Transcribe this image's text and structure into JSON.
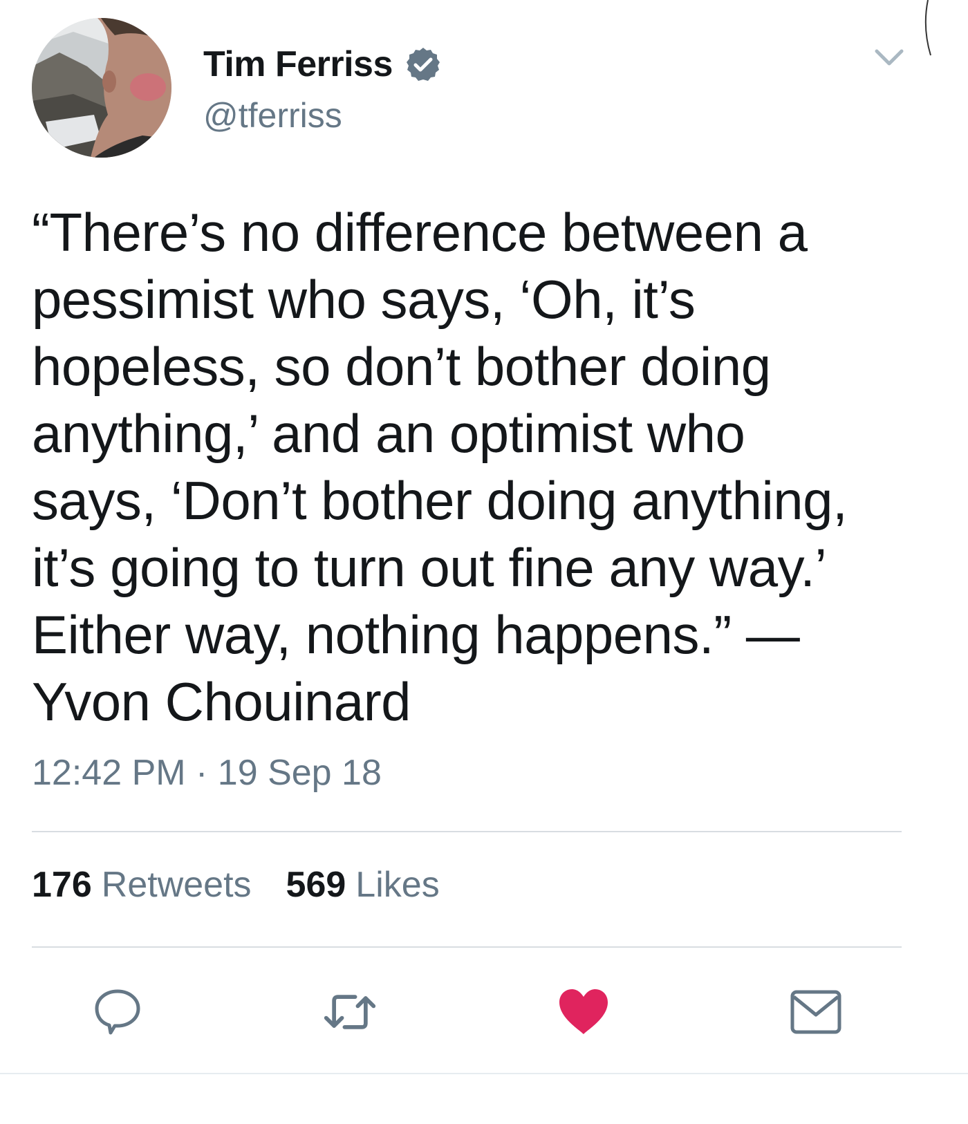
{
  "author": {
    "display_name": "Tim Ferriss",
    "handle": "@tferriss",
    "verified": true
  },
  "tweet": {
    "text": "“There’s no difference between a\npessimist who says, ‘Oh, it’s\nhopeless, so don’t bother doing\nanything,’ and an optimist who\nsays, ‘Don’t bother doing anything,\nit’s going to turn out fine any way.’\nEither way, nothing happens.” —\nYvon Chouinard",
    "timestamp": "12:42 PM · 19 Sep 18"
  },
  "stats": {
    "retweets_count": "176",
    "retweets_label": "Retweets",
    "likes_count": "569",
    "likes_label": "Likes"
  },
  "actions": [
    {
      "name": "reply",
      "icon": "reply-icon"
    },
    {
      "name": "retweet",
      "icon": "retweet-icon"
    },
    {
      "name": "like",
      "icon": "heart-icon",
      "active": true
    },
    {
      "name": "direct-message",
      "icon": "envelope-icon"
    }
  ],
  "colors": {
    "text_primary": "#14171a",
    "text_secondary": "#657786",
    "verified_badge": "#657786",
    "like_active": "#e0245e",
    "divider": "#d8dde1"
  }
}
